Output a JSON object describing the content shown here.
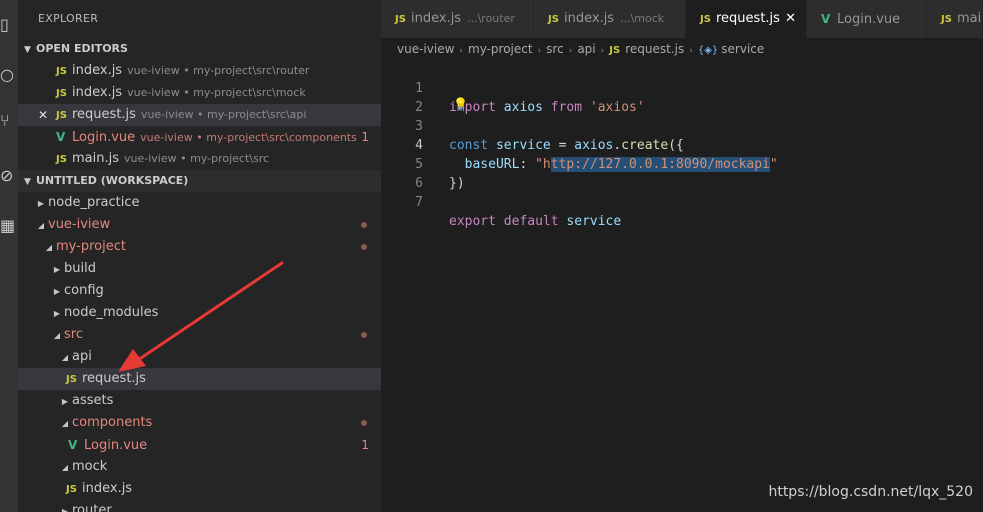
{
  "sidebar": {
    "title": "EXPLORER",
    "open_editors_header": "OPEN EDITORS",
    "open_editors": [
      {
        "icon": "JS",
        "name": "index.js",
        "path": "vue-iview • my-project\\src\\router"
      },
      {
        "icon": "JS",
        "name": "index.js",
        "path": "vue-iview • my-project\\src\\mock"
      },
      {
        "icon": "JS",
        "name": "request.js",
        "path": "vue-iview • my-project\\src\\api",
        "close": "✕"
      },
      {
        "icon": "V",
        "name": "Login.vue",
        "path": "vue-iview • my-project\\src\\components",
        "badge": "1"
      },
      {
        "icon": "JS",
        "name": "main.js",
        "path": "vue-iview • my-project\\src"
      }
    ],
    "workspace_header": "UNTITLED (WORKSPACE)",
    "tree": [
      {
        "name": "node_practice"
      },
      {
        "name": "vue-iview"
      },
      {
        "name": "my-project"
      },
      {
        "name": "build"
      },
      {
        "name": "config"
      },
      {
        "name": "node_modules"
      },
      {
        "name": "src"
      },
      {
        "name": "api"
      },
      {
        "name": "request.js",
        "icon": "JS"
      },
      {
        "name": "assets"
      },
      {
        "name": "components"
      },
      {
        "name": "Login.vue",
        "icon": "V",
        "badge": "1"
      },
      {
        "name": "mock"
      },
      {
        "name": "index.js",
        "icon": "JS"
      },
      {
        "name": "router"
      }
    ]
  },
  "tabs": [
    {
      "icon": "JS",
      "name": "index.js",
      "path": "...\\router"
    },
    {
      "icon": "JS",
      "name": "index.js",
      "path": "...\\mock"
    },
    {
      "icon": "JS",
      "name": "request.js",
      "close": "✕"
    },
    {
      "icon": "V",
      "name": "Login.vue"
    },
    {
      "icon": "JS",
      "name": "main"
    }
  ],
  "breadcrumb": [
    "vue-iview",
    "my-project",
    "src",
    "api",
    "request.js",
    "service"
  ],
  "breadcrumb_service_icon": "{◈}",
  "code": {
    "line_numbers": [
      "1",
      "2",
      "3",
      "4",
      "5",
      "6",
      "7"
    ],
    "l1": {
      "kw": "import",
      "id": "axios",
      "kw2": "from",
      "str": "'axios'"
    },
    "l3": {
      "kw": "const",
      "id": "service",
      "eq": "=",
      "obj": "axios",
      "dot": ".",
      "fn": "create",
      "open": "({"
    },
    "l4": {
      "key": "baseURL",
      "colon": ":",
      "q1": "\"h",
      "url": "ttp://127.0.0.1:8090/mockapi",
      "q2": "\""
    },
    "l5": {
      "close": "})"
    },
    "l7": {
      "kw": "export",
      "kw2": "default",
      "id": "service"
    }
  },
  "watermark": "https://blog.csdn.net/lqx_520",
  "colors": {
    "accent_arrow": "#e53935",
    "modified": "#e2877f",
    "js_icon": "#cbcb41",
    "vue_icon": "#41b883"
  }
}
